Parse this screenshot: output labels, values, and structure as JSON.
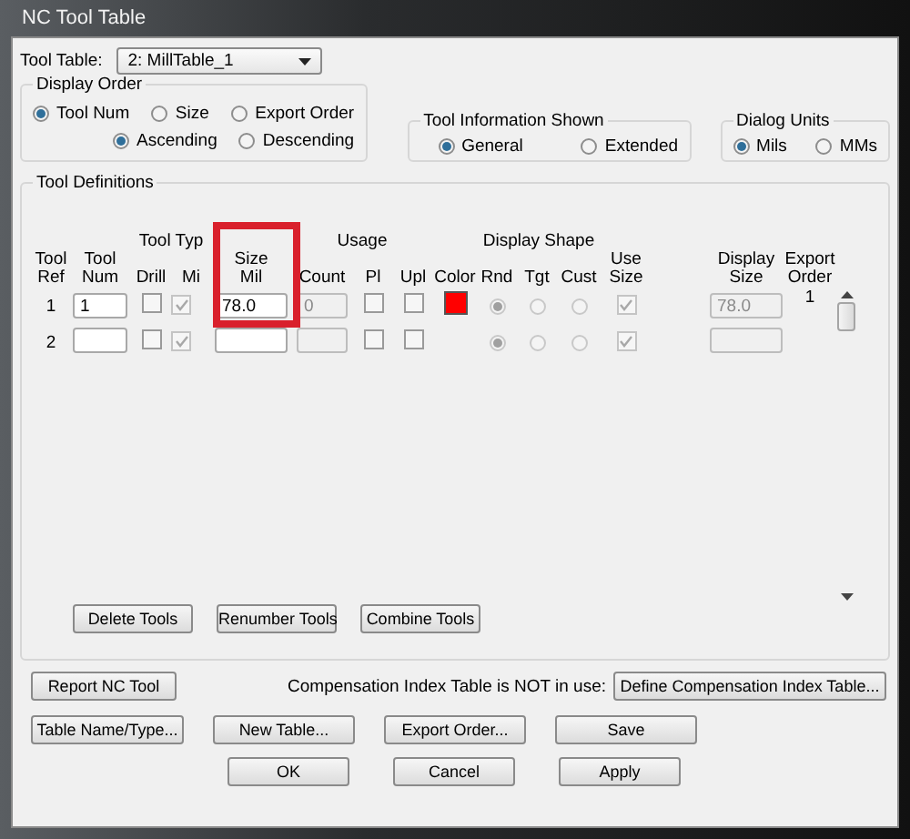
{
  "window": {
    "title": "NC Tool Table"
  },
  "tool_table": {
    "label": "Tool Table:",
    "value": "2: MillTable_1"
  },
  "display_order": {
    "title": "Display Order",
    "sort_by": [
      {
        "label": "Tool Num",
        "selected": true
      },
      {
        "label": "Size",
        "selected": false
      },
      {
        "label": "Export Order",
        "selected": false
      }
    ],
    "direction": [
      {
        "label": "Ascending",
        "selected": true
      },
      {
        "label": "Descending",
        "selected": false
      }
    ]
  },
  "tool_information_shown": {
    "title": "Tool Information Shown",
    "options": [
      {
        "label": "General",
        "selected": true
      },
      {
        "label": "Extended",
        "selected": false
      }
    ]
  },
  "dialog_units": {
    "title": "Dialog Units",
    "options": [
      {
        "label": "Mils",
        "selected": true
      },
      {
        "label": "MMs",
        "selected": false
      }
    ]
  },
  "tool_definitions": {
    "title": "Tool Definitions",
    "group_headers": [
      "Tool Typ",
      "Usage",
      "Display Shape"
    ],
    "columns": [
      [
        "Tool",
        "Ref"
      ],
      [
        "Tool",
        "Num"
      ],
      [
        "Drill"
      ],
      [
        "Mi"
      ],
      [
        "Size",
        "Mil"
      ],
      [
        "Count"
      ],
      [
        "Pl"
      ],
      [
        "Upl"
      ],
      [
        "Color"
      ],
      [
        "Rnd"
      ],
      [
        "Tgt"
      ],
      [
        "Cust"
      ],
      [
        "Use",
        "Size"
      ],
      [
        "Display",
        "Size"
      ],
      [
        "Export",
        "Order"
      ]
    ],
    "rows": [
      {
        "ref": "1",
        "num": "1",
        "drill": false,
        "mill": true,
        "size": "78.0",
        "count": "0",
        "pl": false,
        "upl": false,
        "color": "#ff0000",
        "shape": [
          {
            "selected": true
          },
          {
            "selected": false
          },
          {
            "selected": false
          }
        ],
        "use_size": true,
        "display_size": "78.0",
        "export_order": "1"
      },
      {
        "ref": "2",
        "drill": false,
        "mill": true,
        "pl": false,
        "upl": false,
        "shape": [
          {
            "selected": true
          },
          {
            "selected": false
          },
          {
            "selected": false
          }
        ],
        "use_size": true
      }
    ],
    "buttons": [
      "Delete Tools",
      "Renumber Tools",
      "Combine Tools"
    ]
  },
  "compensation": {
    "note": "Compensation Index Table is NOT in use:",
    "button": "Define Compensation Index Table..."
  },
  "report_button": "Report NC Tool",
  "table_buttons": [
    "Table Name/Type...",
    "New Table...",
    "Export Order...",
    "Save"
  ],
  "dialog_buttons": [
    "OK",
    "Cancel",
    "Apply"
  ]
}
